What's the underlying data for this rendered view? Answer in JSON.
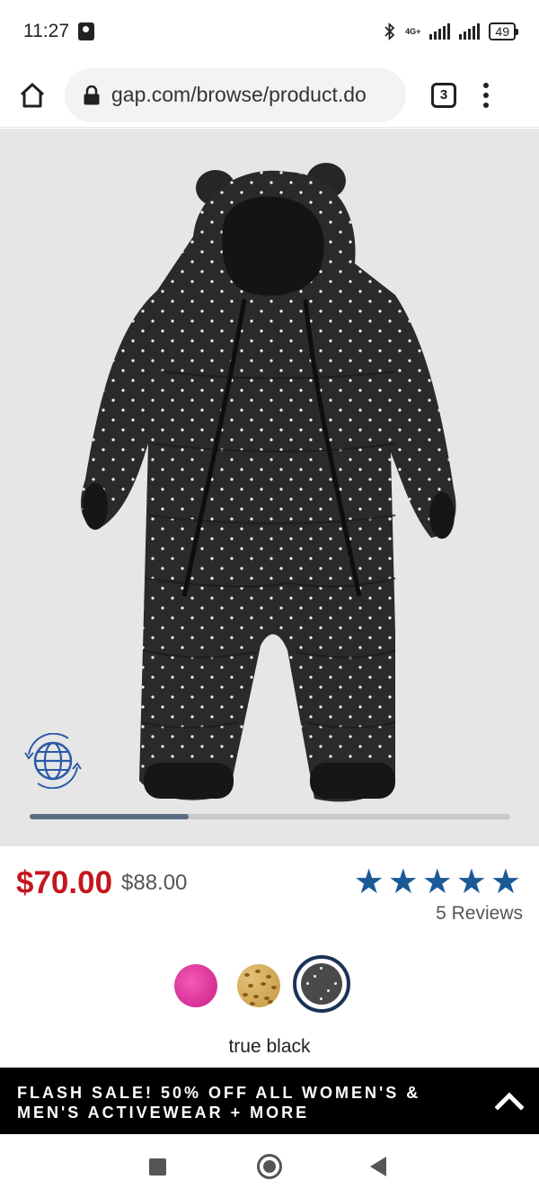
{
  "status_bar": {
    "time": "11:27",
    "network_label": "4G+",
    "battery": "49"
  },
  "browser": {
    "url": "gap.com/browse/product.do",
    "tab_count": "3"
  },
  "product": {
    "image_icon": "translate-globe-icon",
    "carousel_progress": 0.33,
    "sale_price": "$70.00",
    "original_price": "$88.00",
    "rating_stars": 5,
    "reviews": "5 Reviews",
    "swatches": [
      {
        "name": "pink",
        "color": "#e23aa0"
      },
      {
        "name": "leopard",
        "color": "#d4aa55"
      },
      {
        "name": "true black",
        "color": "#4a4a4a",
        "selected": true
      }
    ],
    "selected_color": "true black"
  },
  "banner": {
    "text": "FLASH SALE! 50% OFF ALL WOMEN'S & MEN'S ACTIVEWEAR + MORE"
  },
  "colors": {
    "sale_red": "#c4161c",
    "star_blue": "#1a5a96",
    "selected_ring": "#1b3358"
  }
}
